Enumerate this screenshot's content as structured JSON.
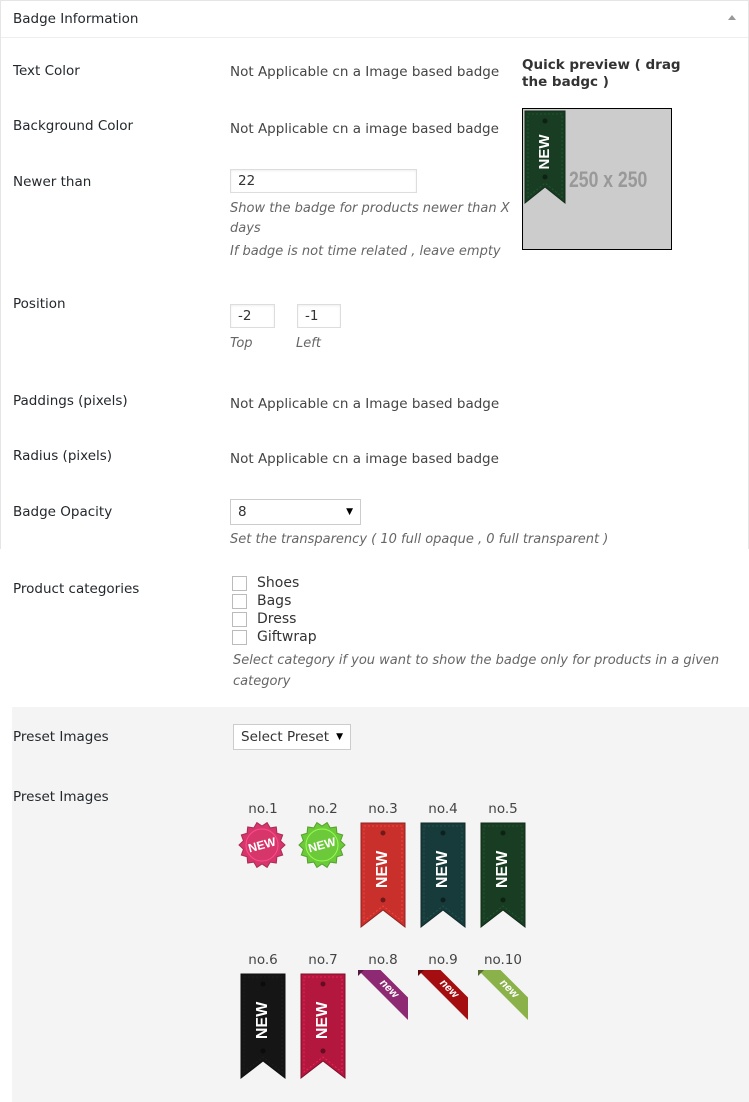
{
  "panel": {
    "title": "Badge Information"
  },
  "fields": {
    "text_color": {
      "label": "Text Color",
      "value": "Not Applicable cn a Image based badge"
    },
    "background_color": {
      "label": "Background Color",
      "value": "Not Applicable cn a image based badge"
    },
    "newer_than": {
      "label": "Newer than",
      "value": "22",
      "help1_line1": "Show the badge for products newer than X",
      "help1_line2": "days",
      "help2": "If badge is not time related , leave empty"
    },
    "position": {
      "label": "Position",
      "top_value": "-2",
      "left_value": "-1",
      "top_label": "Top",
      "left_label": "Left"
    },
    "paddings": {
      "label": "Paddings (pixels)",
      "value": "Not Applicable cn a Image based badge"
    },
    "radius": {
      "label": "Radius (pixels)",
      "value": "Not Applicable cn a image based badge"
    },
    "opacity": {
      "label": "Badge Opacity",
      "value": "8",
      "help": "Set the transparency ( 10 full opaque , 0 full transparent )"
    },
    "categories": {
      "label": "Product categories",
      "items": [
        "Shoes",
        "Bags",
        "Dress",
        "Giftwrap"
      ],
      "help_line1": "Select category if you want to show the badge only for products in a given",
      "help_line2": "category"
    }
  },
  "quick_preview": {
    "title": "Quick preview ( drag the badgc )",
    "placeholder": "250 x 250",
    "badge_text": "NEW"
  },
  "presets": {
    "select_label": "Preset Images",
    "select_value": "Select Preset",
    "images_label": "Preset Images",
    "items": [
      {
        "num": "no.1",
        "text": "NEW",
        "kind": "starburst",
        "color": "#d6366a"
      },
      {
        "num": "no.2",
        "text": "NEW",
        "kind": "starburst",
        "color": "#6cc93a"
      },
      {
        "num": "no.3",
        "text": "NEW",
        "kind": "ribbon",
        "color": "#c9302c"
      },
      {
        "num": "no.4",
        "text": "NEW",
        "kind": "ribbon",
        "color": "#173b3a"
      },
      {
        "num": "no.5",
        "text": "NEW",
        "kind": "ribbon",
        "color": "#183d22"
      },
      {
        "num": "no.6",
        "text": "NEW",
        "kind": "ribbon",
        "color": "#151515"
      },
      {
        "num": "no.7",
        "text": "NEW",
        "kind": "ribbon",
        "color": "#b3173d"
      },
      {
        "num": "no.8",
        "text": "new",
        "kind": "corner",
        "color": "#8e2a73"
      },
      {
        "num": "no.9",
        "text": "new",
        "kind": "corner",
        "color": "#a40e10"
      },
      {
        "num": "no.10",
        "text": "new",
        "kind": "corner",
        "color": "#8ab14a"
      }
    ]
  }
}
